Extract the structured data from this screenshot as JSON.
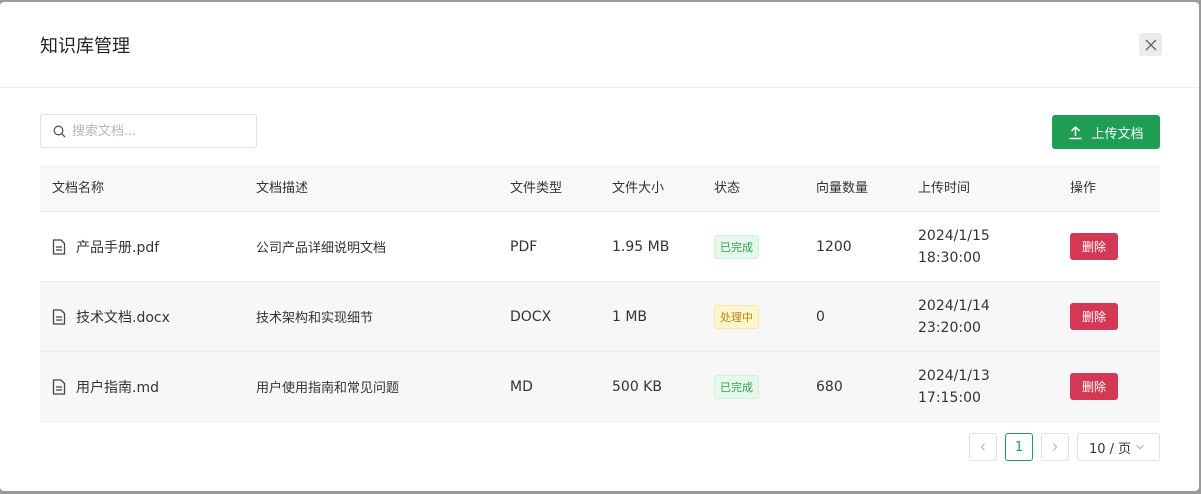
{
  "dialog": {
    "title": "知识库管理",
    "close_icon": "close-icon"
  },
  "search": {
    "placeholder": "搜索文档...",
    "value": "",
    "icon": "search-icon"
  },
  "upload": {
    "label": "上传文档",
    "icon": "upload-icon",
    "color": "#1f9d55"
  },
  "table": {
    "columns": [
      "文档名称",
      "文档描述",
      "文件类型",
      "文件大小",
      "状态",
      "向量数量",
      "上传时间",
      "操作"
    ],
    "rows": [
      {
        "name": "产品手册.pdf",
        "description": "公司产品详细说明文档",
        "type": "PDF",
        "size": "1.95 MB",
        "status": "已完成",
        "vectors": "1200",
        "date": "2024/1/15",
        "time": "18:30:00",
        "action": "删除"
      },
      {
        "name": "技术文档.docx",
        "description": "技术架构和实现细节",
        "type": "DOCX",
        "size": "1 MB",
        "status": "处理中",
        "vectors": "0",
        "date": "2024/1/14",
        "time": "23:20:00",
        "action": "删除"
      },
      {
        "name": "用户指南.md",
        "description": "用户使用指南和常见问题",
        "type": "MD",
        "size": "500 KB",
        "status": "已完成",
        "vectors": "680",
        "date": "2024/1/13",
        "time": "17:15:00",
        "action": "删除"
      }
    ]
  },
  "status_colors": {
    "done": "#2e9e5b",
    "processing": "#b5850b",
    "delete": "#d33954"
  },
  "pagination": {
    "current_page": "1",
    "page_size": "10 / 页",
    "prev_icon": "chevron-left-icon",
    "next_icon": "chevron-right-icon"
  }
}
